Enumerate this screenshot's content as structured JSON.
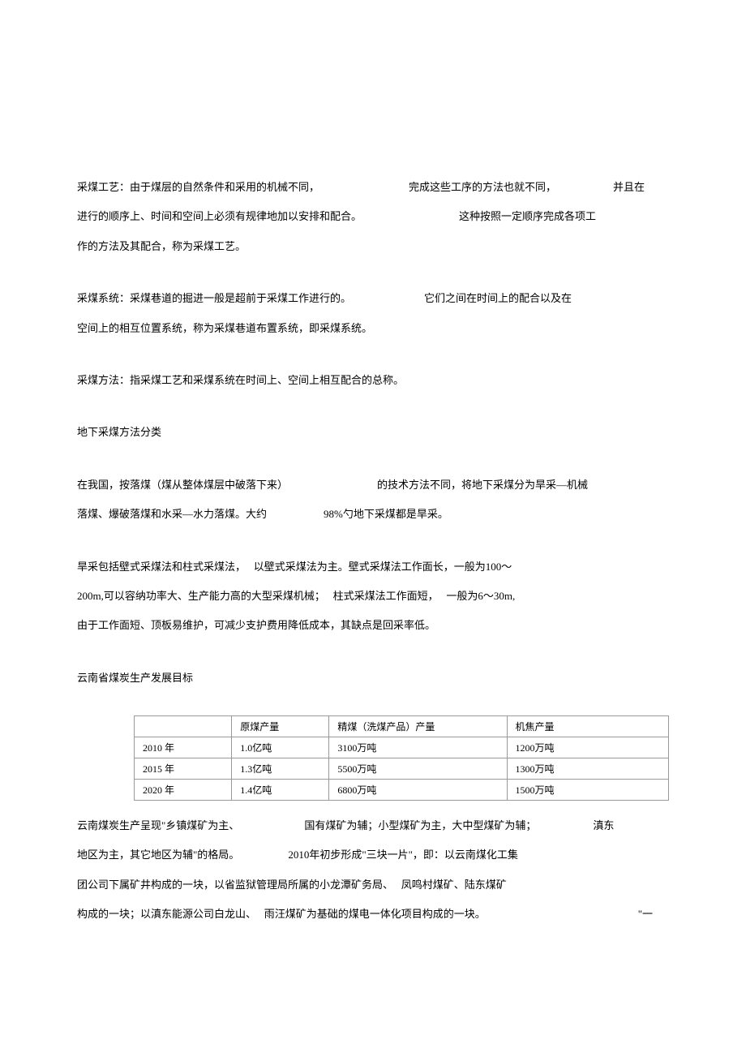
{
  "paragraphs": {
    "p1_seg1": "采煤工艺：由于煤层的自然条件和采用的机械不同，",
    "p1_seg2": "完成这些工序的方法也就不同，",
    "p1_seg3": "并且在",
    "p1_seg4": "进行的顺序上、时间和空间上必须有规律地加以安排和配合。",
    "p1_seg5": "这种按照一定顺序完成各项工",
    "p1_seg6": "作的方法及其配合，称为采煤工艺。",
    "p2_seg1": "采煤系统：采煤巷道的掘进一般是超前于采煤工作进行的。",
    "p2_seg2": "它们之间在时间上的配合以及在",
    "p2_seg3": "空间上的相互位置系统，称为采煤巷道布置系统，即采煤系统。",
    "p3": "采煤方法：指采煤工艺和采煤系统在时间上、空间上相互配合的总称。",
    "h1": "地下采煤方法分类",
    "p4_seg1": "在我国，按落煤（煤从整体煤层中破落下来）",
    "p4_seg2": "的技术方法不同，将地下采煤分为旱采—机械",
    "p4_seg3": "落煤、爆破落煤和水采—水力落煤。大约",
    "p4_seg4": "98%勺地下采煤都是旱采。",
    "p5_seg1": "旱采包括壁式采煤法和柱式采煤法，  以壁式采煤法为主。壁式采煤法工作面长，一般为100～",
    "p5_seg2": "200m,可以容纳功率大、生产能力高的大型采煤机械；  柱式采煤法工作面短，  一般为6～30m,",
    "p5_seg3": "由于工作面短、顶板易维护，可减少支护费用降低成本，其缺点是回采率低。",
    "h2": "云南省煤炭生产发展目标",
    "p6_seg1": "云南煤炭生产呈现\"乡镇煤矿为主、",
    "p6_seg2": "国有煤矿为辅；小型煤矿为主，大中型煤矿为辅；",
    "p6_seg3": "滇东",
    "p6_seg4": "地区为主，其它地区为辅\"的格局。",
    "p6_seg5": "2010年初步形成\"三块一片\"，即：以云南煤化工集",
    "p6_seg6": "团公司下属矿井构成的一块，以省监狱管理局所属的小龙潭矿务局、  凤鸣村煤矿、陆东煤矿",
    "p6_seg7": "构成的一块；以滇东能源公司白龙山、  雨汪煤矿为基础的煤电一体化项目构成的一块。",
    "trailing": "\"一"
  },
  "table": {
    "headers": [
      "",
      "原煤产量",
      "精煤（洗煤产品）产量",
      "机焦产量"
    ],
    "rows": [
      {
        "year": "2010 年",
        "raw": "1.0亿吨",
        "refined": "3100万吨",
        "coke": "1200万吨"
      },
      {
        "year": "2015 年",
        "raw": "1.3亿吨",
        "refined": "5500万吨",
        "coke": "1300万吨"
      },
      {
        "year": "2020 年",
        "raw": "1.4亿吨",
        "refined": "6800万吨",
        "coke": "1500万吨"
      }
    ]
  }
}
